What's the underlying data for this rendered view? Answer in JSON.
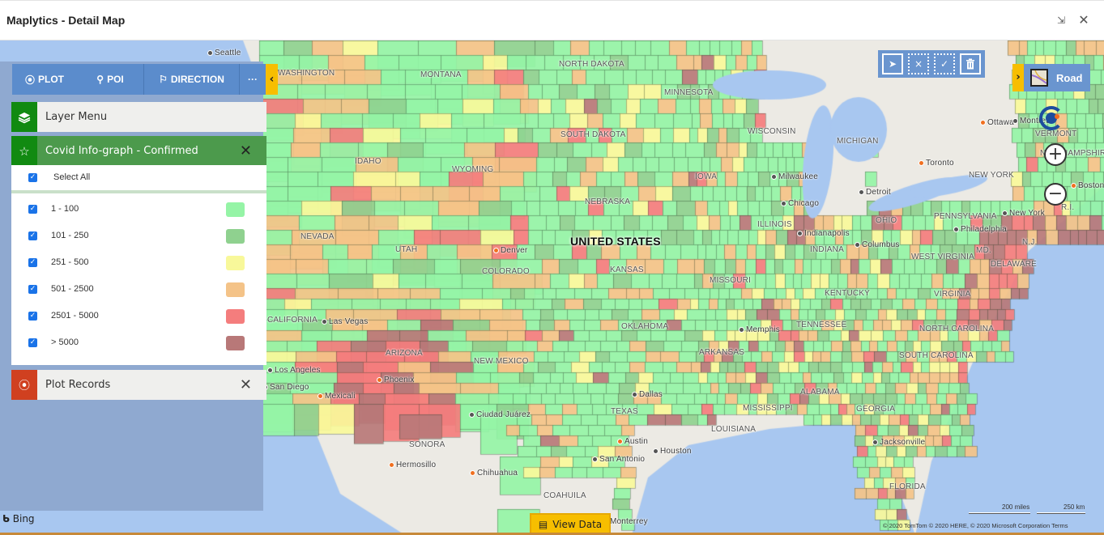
{
  "window": {
    "title": "Maplytics - Detail Map",
    "restore_icon": "restore-icon",
    "close_icon": "close-icon"
  },
  "toolbar": {
    "plot_label": "PLOT",
    "poi_label": "POI",
    "direction_label": "DIRECTION",
    "more_label": "···",
    "collapse_glyph": "‹"
  },
  "layer_menu": {
    "label": "Layer Menu"
  },
  "covid_layer": {
    "title": "Covid Info-graph - Confirmed",
    "select_all_label": "Select All",
    "select_all_checked": true,
    "legend": [
      {
        "label": "1 - 100",
        "color": "#95f4a6",
        "checked": true
      },
      {
        "label": "101 - 250",
        "color": "#8fd18f",
        "checked": true
      },
      {
        "label": "251 - 500",
        "color": "#f8f89a",
        "checked": true
      },
      {
        "label": "501 - 2500",
        "color": "#f4c388",
        "checked": true
      },
      {
        "label": "2501 - 5000",
        "color": "#f47d7d",
        "checked": true
      },
      {
        "label": "> 5000",
        "color": "#b87878",
        "checked": true
      }
    ]
  },
  "plot_records": {
    "label": "Plot Records"
  },
  "selection_tools": [
    "select-pointer-icon",
    "clear-selection-icon",
    "confirm-selection-icon",
    "delete-icon"
  ],
  "map_type": {
    "label": "Road"
  },
  "view_data": {
    "label": "View Data"
  },
  "branding": {
    "bing": "Bing"
  },
  "scale": {
    "miles": "200 miles",
    "km": "250 km"
  },
  "copyright": "© 2020 TomTom © 2020 HERE, © 2020 Microsoft Corporation  Terms",
  "map_labels": {
    "country": "UNITED STATES",
    "states": [
      "MONTANA",
      "NORTH DAKOTA",
      "MINNESOTA",
      "SOUTH DAKOTA",
      "WISCONSIN",
      "IDAHO",
      "WYOMING",
      "IOWA",
      "MICHIGAN",
      "NEBRASKA",
      "NEVADA",
      "UTAH",
      "COLORADO",
      "KANSAS",
      "ILLINOIS",
      "INDIANA",
      "OHIO",
      "PENNSYLVANIA",
      "NEW YORK",
      "MISSOURI",
      "KENTUCKY",
      "WEST VIRGINIA",
      "VIRGINIA",
      "CALIFORNIA",
      "ARIZONA",
      "NEW MEXICO",
      "OKLAHOMA",
      "ARKANSAS",
      "TENNESSEE",
      "NORTH CAROLINA",
      "SOUTH CAROLINA",
      "MISSISSIPPI",
      "ALABAMA",
      "GEORGIA",
      "TEXAS",
      "LOUISIANA",
      "FLORIDA",
      "VERMONT",
      "NEW HAMPSHIRE",
      "DELAWARE",
      "MD.",
      "N.J.",
      "R.I.",
      "SONORA",
      "COAHUILA",
      "WASHINGTON"
    ],
    "cities": [
      "Seattle",
      "Denver",
      "Milwaukee",
      "Chicago",
      "Detroit",
      "Toronto",
      "Ottawa",
      "Montreal",
      "Indianapolis",
      "Columbus",
      "Philadelphia",
      "New York",
      "Boston",
      "Las Vegas",
      "Los Angeles",
      "San Diego",
      "Mexicali",
      "Phoenix",
      "Ciudad Juárez",
      "Hermosillo",
      "Chihuahua",
      "Dallas",
      "Austin",
      "San Antonio",
      "Houston",
      "Memphis",
      "Jacksonville",
      "Monterrey"
    ]
  }
}
